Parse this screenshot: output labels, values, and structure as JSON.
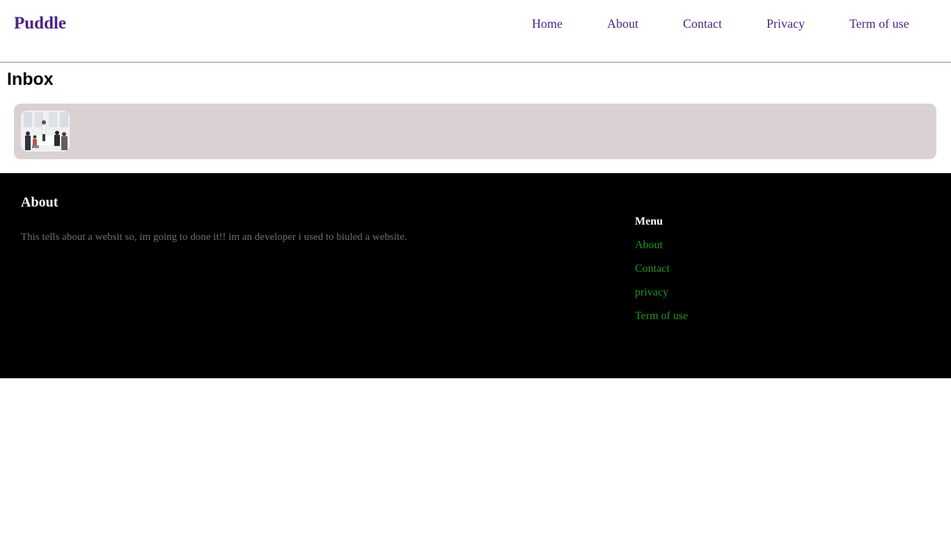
{
  "header": {
    "brand": "Puddle",
    "nav": [
      "Home",
      "About",
      "Contact",
      "Privacy",
      "Term of use"
    ]
  },
  "main": {
    "title": "Inbox",
    "messages": [
      {
        "thumbnail": "group-meeting-photo"
      }
    ]
  },
  "footer": {
    "about_title": "About",
    "about_text": "This tells about a websit so, im going to done it!! im an developer i used to biuled a website.",
    "menu_title": "Menu",
    "menu_links": [
      "About",
      "Contact",
      "privacy",
      "Term of use"
    ]
  },
  "colors": {
    "brand": "#4b2388",
    "card_bg": "#dbd1d2",
    "footer_bg": "#000000",
    "footer_link": "#1e9a1e",
    "footer_text": "#6e6e6e"
  }
}
